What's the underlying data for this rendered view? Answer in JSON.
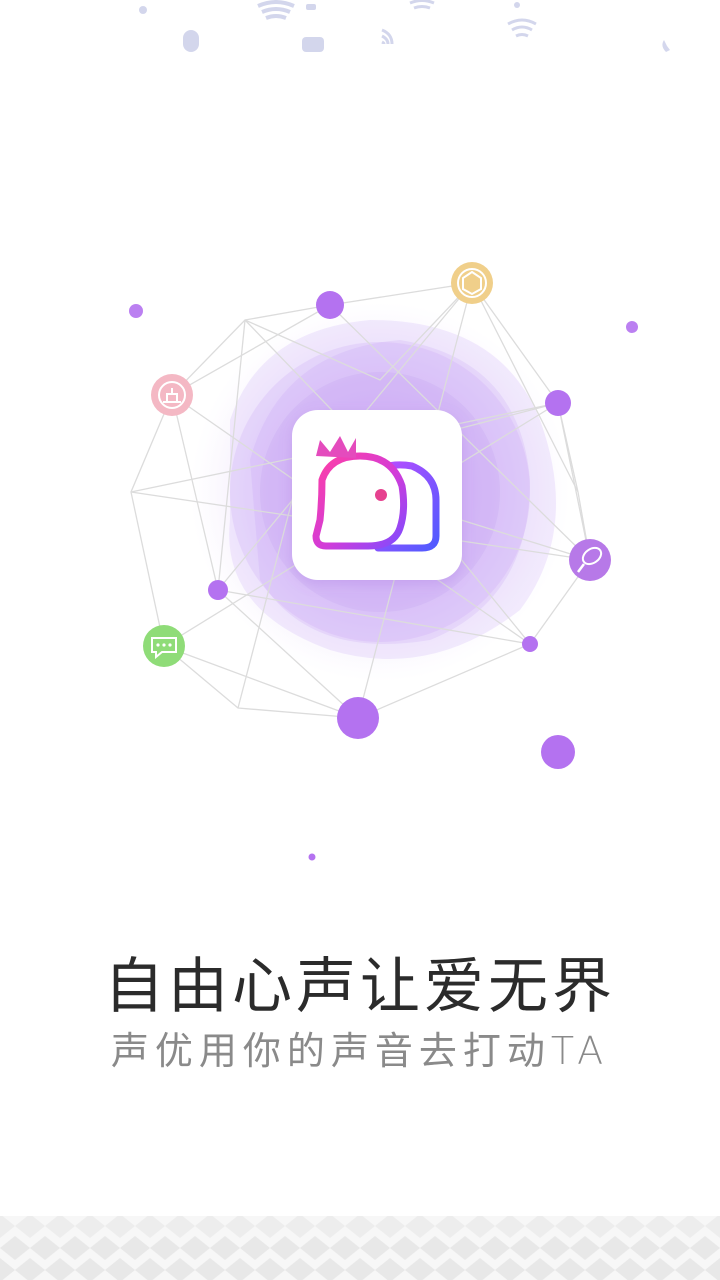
{
  "splash": {
    "headline": "自由心声让爱无界",
    "tagline": "声优用你的声音去打动TA"
  },
  "app_icon": {
    "name": "app-logo",
    "colors": {
      "gradient_start": "#ff3fa4",
      "gradient_mid": "#b03cff",
      "gradient_end": "#5a5cff"
    }
  },
  "network_nodes": [
    {
      "name": "podium-node-icon",
      "icon": "podium",
      "color": "#f4b8c4"
    },
    {
      "name": "hexagon-node-icon",
      "icon": "hexagon-badge",
      "color": "#f0cf8a"
    },
    {
      "name": "microphone-node-icon",
      "icon": "microphone",
      "color": "#b779e8"
    },
    {
      "name": "chat-node-icon",
      "icon": "chat-bubble",
      "color": "#8fdc78"
    }
  ],
  "theme": {
    "accent_purple": "#b472f0",
    "halo_purple": "#c9a4f5",
    "text_dark": "#2b2b2b",
    "text_light": "#8a8a8a"
  }
}
